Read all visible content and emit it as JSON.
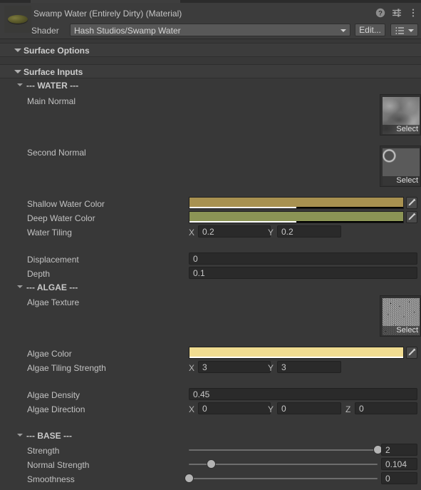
{
  "window": {
    "title": "Swamp Water (Entirely Dirty) (Material)",
    "help_icon": "help-icon",
    "settings_icon": "preset-settings-icon",
    "menu_icon": "kebab-menu-icon"
  },
  "shader": {
    "label": "Shader",
    "value": "Hash Studios/Swamp Water",
    "edit_label": "Edit...",
    "preset_icon": "shader-list-icon"
  },
  "sections": {
    "surface_options": "Surface Options",
    "surface_inputs": "Surface Inputs",
    "water": "--- WATER ---",
    "algae": "--- ALGAE ---",
    "base": "--- BASE ---"
  },
  "water": {
    "main_normal": {
      "label": "Main Normal",
      "select_label": "Select",
      "texture_icon": "main-normal-texture-preview"
    },
    "second_normal": {
      "label": "Second Normal",
      "select_label": "Select",
      "texture_icon": "second-normal-texture-preview"
    },
    "shallow_water_color": {
      "label": "Shallow Water Color",
      "color": "#a89150",
      "alpha_percent": 50,
      "eyedropper_icon": "eyedropper-icon"
    },
    "deep_water_color": {
      "label": "Deep Water Color",
      "color": "#8b9455",
      "alpha_percent": 50,
      "eyedropper_icon": "eyedropper-icon"
    },
    "water_tiling": {
      "label": "Water Tiling",
      "x_label": "X",
      "x": "0.2",
      "y_label": "Y",
      "y": "0.2"
    },
    "displacement": {
      "label": "Displacement",
      "value": "0"
    },
    "depth": {
      "label": "Depth",
      "value": "0.1"
    }
  },
  "algae": {
    "texture": {
      "label": "Algae Texture",
      "select_label": "Select",
      "texture_icon": "algae-texture-preview"
    },
    "color": {
      "label": "Algae Color",
      "color": "#f0dc91",
      "alpha_percent": 100,
      "eyedropper_icon": "eyedropper-icon"
    },
    "tiling_strength": {
      "label": "Algae Tiling Strength",
      "x_label": "X",
      "x": "3",
      "y_label": "Y",
      "y": "3"
    },
    "density": {
      "label": "Algae Density",
      "value": "0.45"
    },
    "direction": {
      "label": "Algae Direction",
      "x_label": "X",
      "x": "0",
      "y_label": "Y",
      "y": "0",
      "z_label": "Z",
      "z": "0"
    }
  },
  "base": {
    "strength": {
      "label": "Strength",
      "value": "2",
      "percent": 100
    },
    "normal_strength": {
      "label": "Normal Strength",
      "value": "0.104",
      "percent": 12
    },
    "smoothness": {
      "label": "Smoothness",
      "value": "0",
      "percent": 0
    }
  },
  "theme": {
    "background": "#383838",
    "header_background": "#3c3c3c",
    "field_background": "#2a2a2a",
    "button_background": "#585858",
    "text": "#c2c2c2"
  }
}
